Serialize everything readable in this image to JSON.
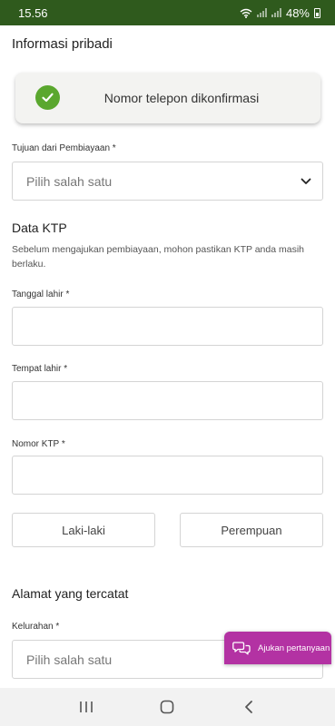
{
  "status_bar": {
    "time": "15.56",
    "battery": "48%"
  },
  "page": {
    "section_personal": "Informasi pribadi",
    "verify_card": {
      "text": "Nomor telepon dikonfirmasi"
    },
    "purpose": {
      "label": "Tujuan dari Pembiayaan *",
      "value": "Pilih salah satu"
    },
    "ktp_section": {
      "title": "Data KTP",
      "description": "Sebelum mengajukan pembiayaan, mohon pastikan KTP anda masih berlaku."
    },
    "birth_date": {
      "label": "Tanggal lahir *",
      "value": ""
    },
    "birth_place": {
      "label": "Tempat lahir *",
      "value": ""
    },
    "ktp_number": {
      "label": "Nomor KTP *",
      "value": ""
    },
    "gender": {
      "male": "Laki-laki",
      "female": "Perempuan"
    },
    "address_section": {
      "title": "Alamat yang tercatat"
    },
    "kelurahan": {
      "label": "Kelurahan *",
      "value": "Pilih salah satu"
    },
    "fab": {
      "label": "Ajukan pertanyaan"
    }
  },
  "colors": {
    "status_bar": "#2f5a1d",
    "check": "#5aa72e",
    "fab": "#b332a3"
  }
}
